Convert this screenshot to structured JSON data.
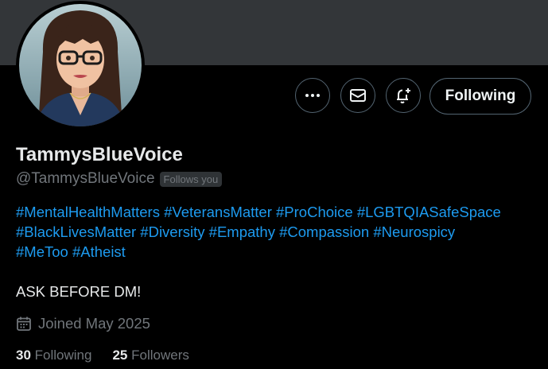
{
  "profile": {
    "display_name": "TammysBlueVoice",
    "handle": "@TammysBlueVoice",
    "follows_you": "Follows you",
    "note": "ASK BEFORE DM!",
    "joined": "Joined May 2025"
  },
  "bio": {
    "line1": [
      "#MentalHealthMatters",
      "#VeteransMatter",
      "#ProChoice",
      "#LGBTQIASafeSpace"
    ],
    "line2": [
      "#BlackLivesMatter",
      "#Diversity",
      "#Empathy",
      "#Compassion",
      "#Neurospicy"
    ],
    "line3": [
      "#MeToo",
      "#Atheist"
    ]
  },
  "actions": {
    "more_icon": "more-icon",
    "message_icon": "envelope-icon",
    "notify_icon": "bell-plus-icon",
    "follow_label": "Following"
  },
  "stats": {
    "following_count": "30",
    "following_label": "Following",
    "followers_count": "25",
    "followers_label": "Followers"
  },
  "colors": {
    "background": "#000000",
    "banner": "#333639",
    "link": "#1d9bf0",
    "muted": "#71767b",
    "text": "#e7e9ea",
    "border": "#536471"
  }
}
